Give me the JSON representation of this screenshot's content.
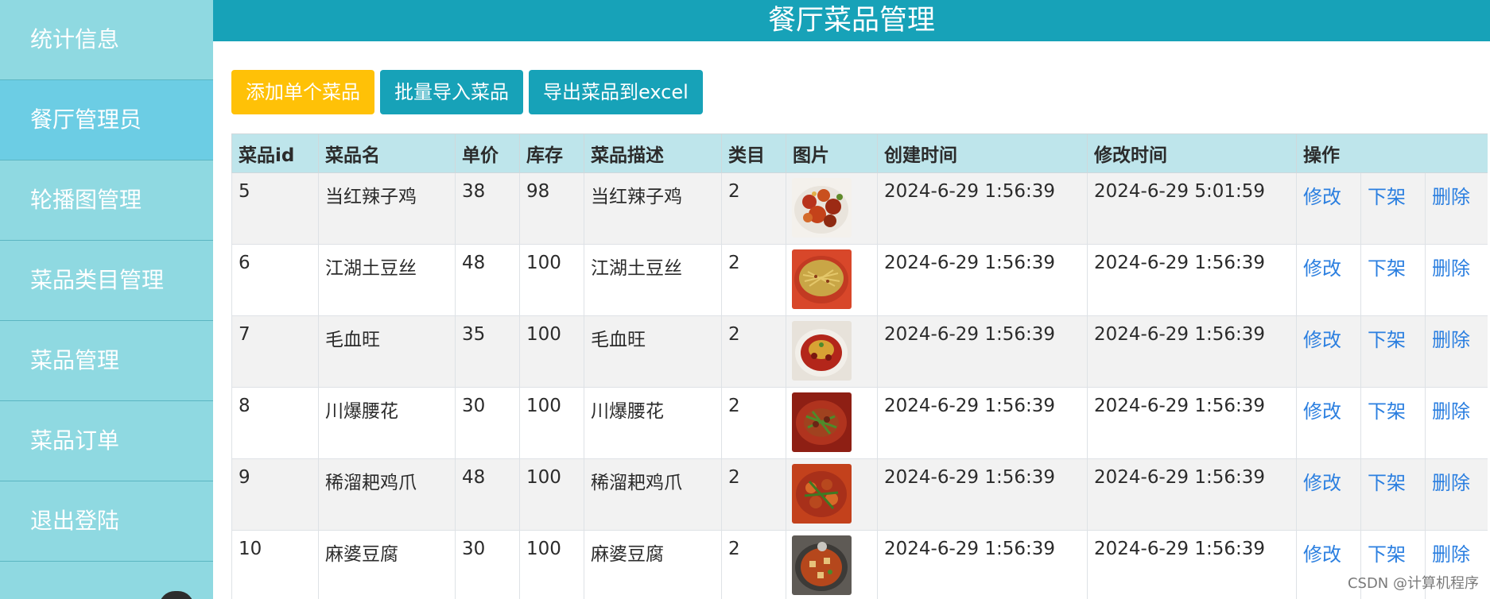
{
  "sidebar": {
    "items": [
      {
        "label": "统计信息",
        "active": false
      },
      {
        "label": "餐厅管理员",
        "active": true
      },
      {
        "label": "轮播图管理",
        "active": false
      },
      {
        "label": "菜品类目管理",
        "active": false
      },
      {
        "label": "菜品管理",
        "active": false
      },
      {
        "label": "菜品订单",
        "active": false
      },
      {
        "label": "退出登陆",
        "active": false
      }
    ]
  },
  "header": {
    "title": "餐厅菜品管理"
  },
  "toolbar": {
    "add_label": "添加单个菜品",
    "import_label": "批量导入菜品",
    "export_label": "导出菜品到excel"
  },
  "table": {
    "headers": [
      "菜品id",
      "菜品名",
      "单价",
      "库存",
      "菜品描述",
      "类目",
      "图片",
      "创建时间",
      "修改时间",
      "操作"
    ],
    "action_labels": {
      "edit": "修改",
      "offshelf": "下架",
      "delete": "删除"
    },
    "rows": [
      {
        "id": "5",
        "name": "当红辣子鸡",
        "price": "38",
        "stock": "98",
        "desc": "当红辣子鸡",
        "category": "2",
        "image_icon": "dish-photo-icon",
        "created": "2024-6-29 1:56:39",
        "modified": "2024-6-29 5:01:59"
      },
      {
        "id": "6",
        "name": "江湖土豆丝",
        "price": "48",
        "stock": "100",
        "desc": "江湖土豆丝",
        "category": "2",
        "image_icon": "dish-photo-icon",
        "created": "2024-6-29 1:56:39",
        "modified": "2024-6-29 1:56:39"
      },
      {
        "id": "7",
        "name": "毛血旺",
        "price": "35",
        "stock": "100",
        "desc": "毛血旺",
        "category": "2",
        "image_icon": "dish-photo-icon",
        "created": "2024-6-29 1:56:39",
        "modified": "2024-6-29 1:56:39"
      },
      {
        "id": "8",
        "name": "川爆腰花",
        "price": "30",
        "stock": "100",
        "desc": "川爆腰花",
        "category": "2",
        "image_icon": "dish-photo-icon",
        "created": "2024-6-29 1:56:39",
        "modified": "2024-6-29 1:56:39"
      },
      {
        "id": "9",
        "name": "稀溜耙鸡爪",
        "price": "48",
        "stock": "100",
        "desc": "稀溜耙鸡爪",
        "category": "2",
        "image_icon": "dish-photo-icon",
        "created": "2024-6-29 1:56:39",
        "modified": "2024-6-29 1:56:39"
      },
      {
        "id": "10",
        "name": "麻婆豆腐",
        "price": "30",
        "stock": "100",
        "desc": "麻婆豆腐",
        "category": "2",
        "image_icon": "dish-photo-icon",
        "created": "2024-6-29 1:56:39",
        "modified": "2024-6-29 1:56:39"
      }
    ]
  },
  "watermark": {
    "text": "CSDN @计算机程序"
  },
  "colors": {
    "header_bg": "#17a2b8",
    "sidebar_bg": "#8fd9e1",
    "sidebar_active_bg": "#6ccde4",
    "table_header_bg": "#bee5eb",
    "add_button_bg": "#ffc107",
    "info_button_bg": "#17a2b8",
    "link_color": "#2b7fe0"
  }
}
